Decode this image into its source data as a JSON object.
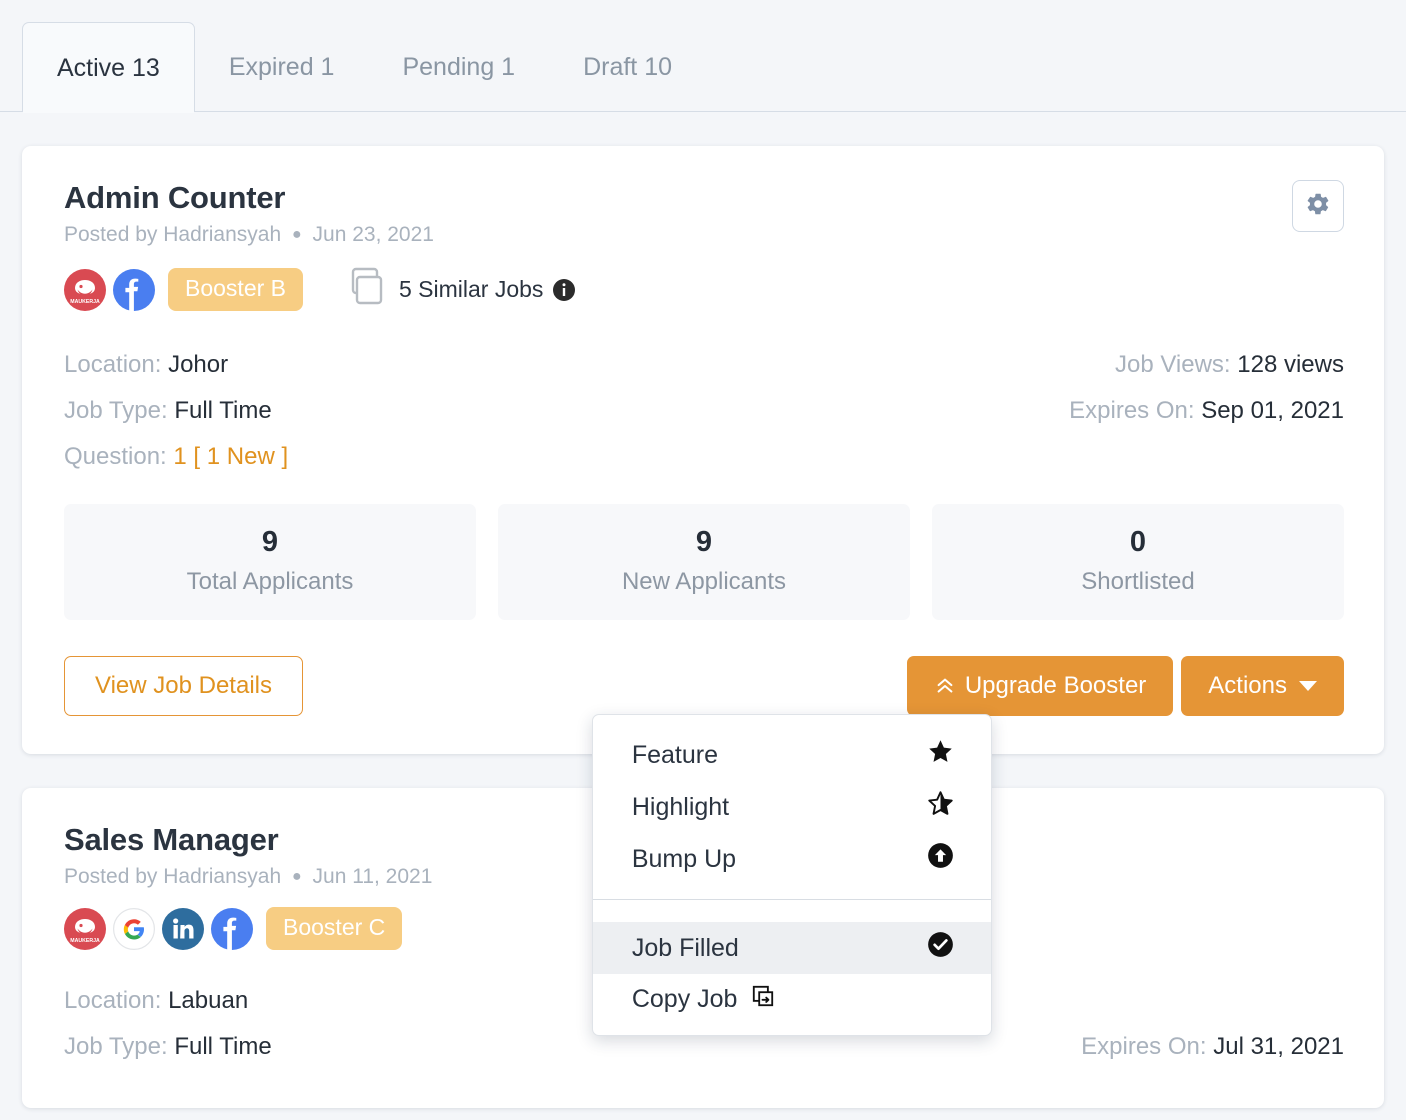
{
  "tabs": [
    {
      "label": "Active 13",
      "active": true
    },
    {
      "label": "Expired 1",
      "active": false
    },
    {
      "label": "Pending 1",
      "active": false
    },
    {
      "label": "Draft 10",
      "active": false
    }
  ],
  "colors": {
    "page_bg": "#f4f6f9",
    "accent_orange": "#e59536",
    "booster_badge": "#f7cd83",
    "maukerja_red": "#d94a52",
    "facebook_blue": "#4a7ef0",
    "linkedin_blue": "#2e6d9e",
    "muted_text": "#a9b2bd"
  },
  "cards": [
    {
      "title": "Admin Counter",
      "posted_prefix": "Posted by",
      "posted_by": "Hadriansyah",
      "posted_date": "Jun 23, 2021",
      "channels": [
        "maukerja-icon",
        "facebook-icon"
      ],
      "booster_label": "Booster B",
      "similar_jobs": "5 Similar Jobs",
      "meta_left": [
        {
          "label": "Location:",
          "value": "Johor",
          "orange": false
        },
        {
          "label": "Job Type:",
          "value": "Full Time",
          "orange": false
        },
        {
          "label": "Question:",
          "value": "1 [ 1 New ]",
          "orange": true
        }
      ],
      "meta_right": [
        {
          "label": "Job Views:",
          "value": "128 views"
        },
        {
          "label": "Expires On:",
          "value": "Sep 01, 2021"
        }
      ],
      "stats": [
        {
          "number": "9",
          "label": "Total Applicants"
        },
        {
          "number": "9",
          "label": "New Applicants"
        },
        {
          "number": "0",
          "label": "Shortlisted"
        }
      ],
      "view_details_label": "View Job Details",
      "upgrade_label": "Upgrade Booster",
      "actions_label": "Actions",
      "dropdown": {
        "open": true,
        "items": [
          {
            "label": "Feature",
            "icon": "star-filled-icon",
            "highlighted": false,
            "inline": false
          },
          {
            "label": "Highlight",
            "icon": "star-outline-icon",
            "highlighted": false,
            "inline": false
          },
          {
            "label": "Bump Up",
            "icon": "arrow-up-circle-icon",
            "highlighted": false,
            "inline": false
          },
          {
            "label": "Job Filled",
            "icon": "check-circle-icon",
            "highlighted": true,
            "inline": false
          },
          {
            "label": "Copy Job",
            "icon": "copy-icon",
            "highlighted": false,
            "inline": true
          }
        ]
      }
    },
    {
      "title": "Sales Manager",
      "posted_prefix": "Posted by",
      "posted_by": "Hadriansyah",
      "posted_date": "Jun 11, 2021",
      "channels": [
        "maukerja-icon",
        "google-icon",
        "linkedin-icon",
        "facebook-icon"
      ],
      "booster_label": "Booster C",
      "meta_left": [
        {
          "label": "Location:",
          "value": "Labuan",
          "orange": false
        },
        {
          "label": "Job Type:",
          "value": "Full Time",
          "orange": false
        }
      ],
      "meta_right": [
        {
          "label": "Expires On:",
          "value": "Jul 31, 2021"
        }
      ]
    }
  ]
}
